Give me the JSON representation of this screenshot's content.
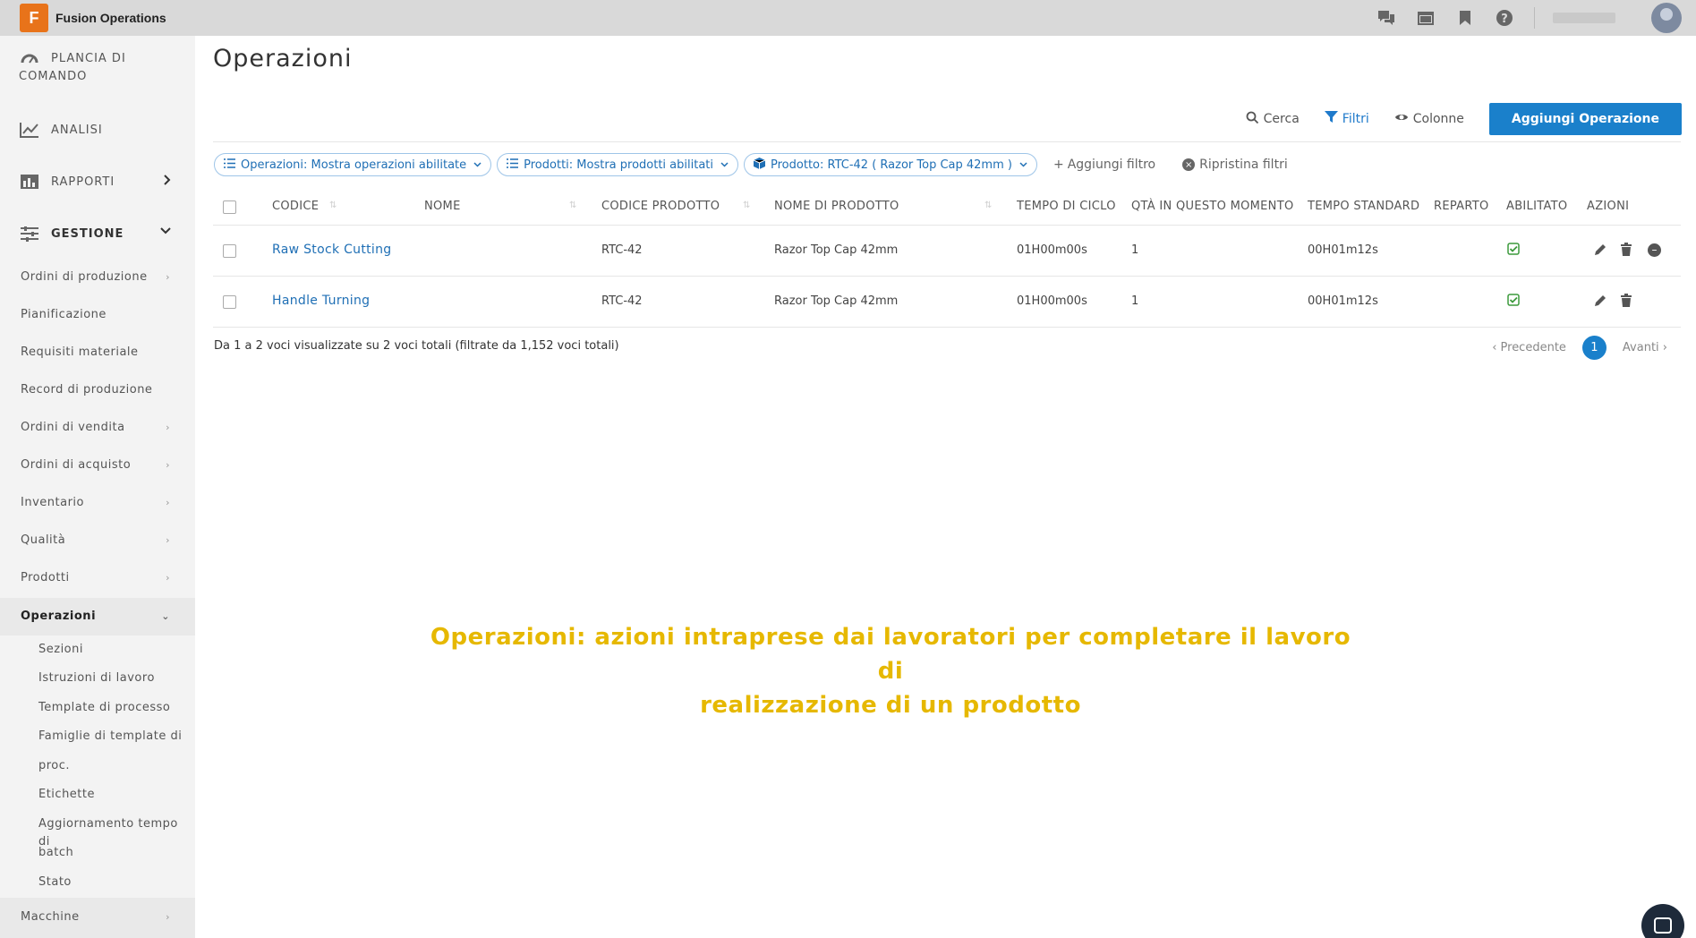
{
  "app": {
    "logo_letter": "F",
    "title": "Fusion Operations"
  },
  "topbar": {
    "icons": [
      "chat-icon",
      "calendar-icon",
      "bookmark-icon",
      "help-icon"
    ],
    "help_glyph": "?"
  },
  "sidebar": {
    "majors": [
      {
        "name": "dashboard",
        "icon": "dashboard-icon",
        "label_line1": "PLANCIA DI",
        "label_line2": "COMANDO"
      },
      {
        "name": "analytics",
        "icon": "chart-icon",
        "label": "ANALISI"
      },
      {
        "name": "reports",
        "icon": "reports-icon",
        "label": "RAPPORTI"
      },
      {
        "name": "management",
        "icon": "sliders-icon",
        "label": "GESTIONE"
      }
    ],
    "items": [
      {
        "label": "Ordini di produzione",
        "has_sub": true
      },
      {
        "label": "Pianificazione",
        "has_sub": false
      },
      {
        "label": "Requisiti materiale",
        "has_sub": false
      },
      {
        "label": "Record di produzione",
        "has_sub": false
      },
      {
        "label": "Ordini di vendita",
        "has_sub": true
      },
      {
        "label": "Ordini di acquisto",
        "has_sub": true
      },
      {
        "label": "Inventario",
        "has_sub": true
      },
      {
        "label": "Qualità",
        "has_sub": true
      },
      {
        "label": "Prodotti",
        "has_sub": true
      },
      {
        "label": "Operazioni",
        "has_sub": true,
        "active": true
      }
    ],
    "subitems": [
      "Sezioni",
      "Istruzioni di lavoro",
      "Template di processo",
      "Famiglie di template di",
      "proc.",
      "Etichette",
      "Aggiornamento tempo di",
      "batch",
      "Stato"
    ],
    "bottom_item": "Macchine"
  },
  "page": {
    "title": "Operazioni"
  },
  "toolbar": {
    "search_label": "Cerca",
    "filters_label": "Filtri",
    "columns_label": "Colonne",
    "add_label": "Aggiungi Operazione"
  },
  "filters": {
    "chips": [
      "Operazioni: Mostra operazioni abilitate",
      "Prodotti: Mostra prodotti abilitati",
      "Prodotto: RTC-42 ( Razor Top Cap 42mm )"
    ],
    "add_filter": "Aggiungi filtro",
    "reset_filters": "Ripristina filtri"
  },
  "table": {
    "headers": {
      "code": "CODICE",
      "name": "NOME",
      "product_code": "CODICE PRODOTTO",
      "product_name": "NOME DI PRODOTTO",
      "cycle_time": "TEMPO DI CICLO",
      "qty": "QTÀ IN QUESTO MOMENTO",
      "std_time": "TEMPO STANDARD",
      "dept": "REPARTO",
      "enabled": "ABILITATO",
      "actions": "AZIONI"
    },
    "rows": [
      {
        "code": "Raw Stock Cutting",
        "name": "",
        "product_code": "RTC-42",
        "product_name": "Razor Top Cap 42mm",
        "cycle_time": "01H00m00s",
        "qty": "1",
        "std_time": "00H01m12s",
        "dept": "",
        "enabled": true
      },
      {
        "code": "Handle Turning",
        "name": "",
        "product_code": "RTC-42",
        "product_name": "Razor Top Cap 42mm",
        "cycle_time": "01H00m00s",
        "qty": "1",
        "std_time": "00H01m12s",
        "dept": "",
        "enabled": true
      }
    ]
  },
  "footer": {
    "info": "Da 1 a 2 voci visualizzate su 2 voci totali (filtrate da 1,152 voci totali)",
    "prev": "‹ Precedente",
    "page": "1",
    "next": "Avanti ›"
  },
  "caption": {
    "line1": "Operazioni: azioni intraprese dai lavoratori per completare il lavoro di",
    "line2": "realizzazione di un prodotto"
  },
  "colors": {
    "accent": "#1a80cb",
    "caption": "#e6b800",
    "logo": "#e8731a",
    "enabled_check": "#3c9a3c"
  }
}
